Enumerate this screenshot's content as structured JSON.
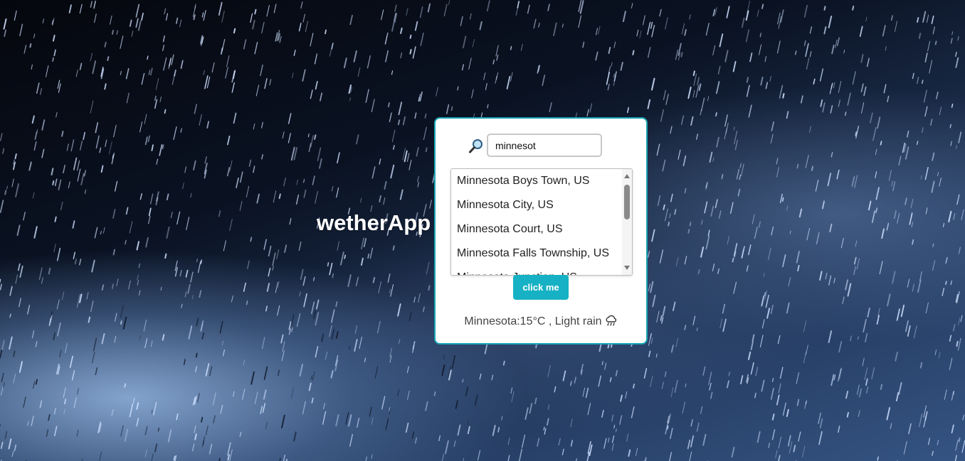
{
  "app": {
    "title": "wetherApp"
  },
  "search": {
    "value": "minnesot",
    "icon": "magnifying-glass-icon"
  },
  "suggestions": [
    "Minnesota Boys Town, US",
    "Minnesota City, US",
    "Minnesota Court, US",
    "Minnesota Falls Township, US",
    "Minnesota Junction, US"
  ],
  "submit": {
    "label": "click me"
  },
  "result": {
    "text": "Minnesota:15°C , Light rain",
    "icon": "rain-cloud-icon"
  },
  "colors": {
    "accent": "#16b1c4",
    "card_border": "#1aa5b5",
    "card_background": "#ffffff"
  }
}
